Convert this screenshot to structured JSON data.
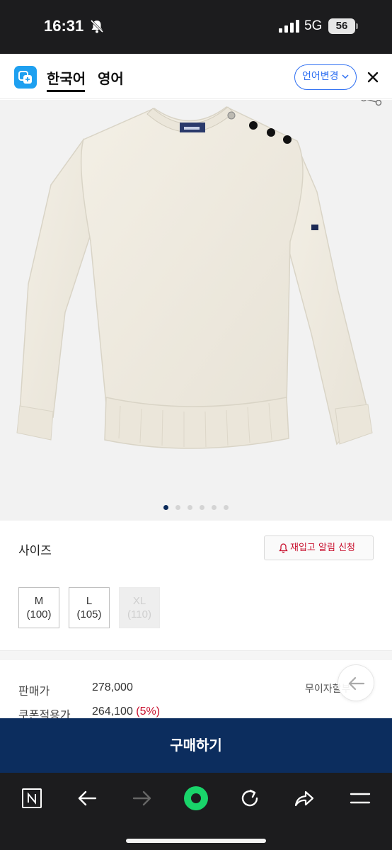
{
  "status_bar": {
    "time": "16:31",
    "network": "5G",
    "battery": "56"
  },
  "translate_bar": {
    "tabs": [
      {
        "label": "한국어",
        "active": true
      },
      {
        "label": "영어",
        "active": false
      }
    ],
    "change_language": "언어변경"
  },
  "product": {
    "image_description_icon": "sweater-image",
    "page_dots": 6,
    "current_page": 1
  },
  "size_section": {
    "label": "사이즈",
    "restock_button": "재입고 알림 신청",
    "options": [
      {
        "name": "M",
        "value": "(100)",
        "available": true
      },
      {
        "name": "L",
        "value": "(105)",
        "available": true
      },
      {
        "name": "XL",
        "value": "(110)",
        "available": false
      }
    ]
  },
  "price_section": {
    "sale_price_label": "판매가",
    "sale_price": "278,000",
    "coupon_price_label": "쿠폰적용가",
    "coupon_price": "264,100",
    "discount_rate": "(5%)",
    "installment_label": "무이자할부"
  },
  "buy_button": "구매하기",
  "colors": {
    "brand_navy": "#0c2d5e",
    "accent_red": "#c8102e",
    "translate_blue": "#2e6ff2"
  },
  "toolbar_icons": [
    "naver-n-icon",
    "back-arrow-icon",
    "forward-arrow-icon",
    "green-home-icon",
    "refresh-icon",
    "share-icon",
    "menu-icon"
  ]
}
